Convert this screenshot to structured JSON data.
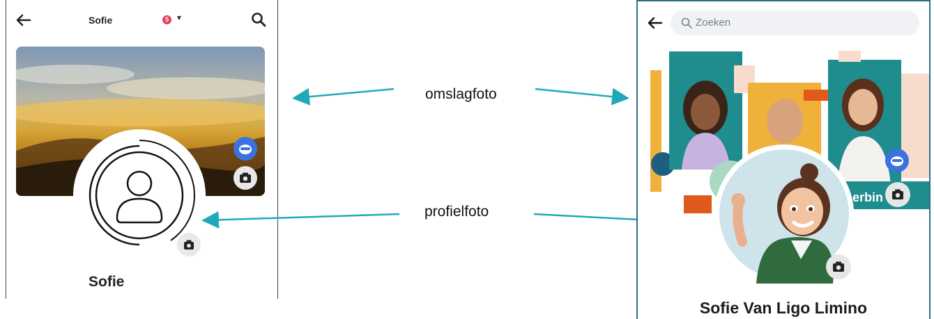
{
  "left_phone": {
    "title": "Sofie",
    "notification_count": "5",
    "profile_name": "Sofie"
  },
  "right_phone": {
    "search_placeholder": "Zoeken",
    "cover_partial_text": "erbin",
    "profile_name": "Sofie Van Ligo Limino"
  },
  "annotations": {
    "cover_label": "omslagfoto",
    "profile_label": "profielfoto",
    "arrow_color": "#1fa9b8"
  },
  "icons": [
    "back-arrow-icon",
    "search-icon",
    "chevron-down-icon",
    "camera-icon",
    "avatar-icon",
    "default-profile-icon"
  ]
}
